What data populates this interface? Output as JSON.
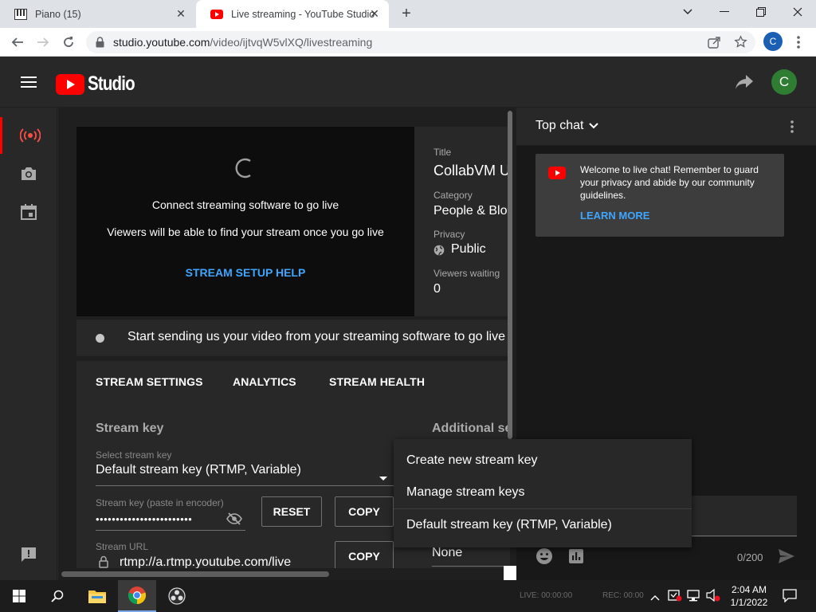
{
  "browser": {
    "tabs": [
      {
        "title": "Piano (15)",
        "icon": "piano-icon"
      },
      {
        "title": "Live streaming - YouTube Studio",
        "icon": "youtube-icon"
      }
    ],
    "url_host": "studio.youtube.com",
    "url_path": "/video/ijtvqW5vlXQ/livestreaming",
    "profile_initial": "C"
  },
  "header": {
    "logo_text": "Studio",
    "avatar_initial": "C"
  },
  "preview": {
    "line1": "Connect streaming software to go live",
    "line2": "Viewers will be able to find your stream once you go live",
    "help_link": "STREAM SETUP HELP"
  },
  "info": {
    "title_label": "Title",
    "title_value": "CollabVM U",
    "category_label": "Category",
    "category_value": "People & Blo",
    "privacy_label": "Privacy",
    "privacy_value": "Public",
    "viewers_label": "Viewers waiting",
    "viewers_value": "0"
  },
  "status": {
    "text": "Start sending us your video from your streaming software to go live"
  },
  "settings": {
    "tabs": [
      "STREAM SETTINGS",
      "ANALYTICS",
      "STREAM HEALTH"
    ],
    "stream_key_heading": "Stream key",
    "additional_heading": "Additional se",
    "select_label": "Select stream key",
    "select_value": "Default stream key (RTMP, Variable)",
    "key_label": "Stream key (paste in encoder)",
    "key_value": "••••••••••••••••••••••••",
    "reset_label": "RESET",
    "copy_label": "COPY",
    "url_label": "Stream URL",
    "url_value": "rtmp://a.rtmp.youtube.com/live",
    "copy2_label": "COPY",
    "none_value": "None"
  },
  "chat": {
    "header": "Top chat",
    "welcome_text": "Welcome to live chat! Remember to guard your privacy and abide by our community guidelines.",
    "learn_more": "LEARN MORE",
    "counter": "0/200"
  },
  "menu": {
    "items": [
      "Create new stream key",
      "Manage stream keys",
      "Default stream key (RTMP, Variable)"
    ]
  },
  "taskbar": {
    "time": "2:04 AM",
    "date": "1/1/2022",
    "live_status": "LIVE: 00:00:00",
    "rec_status": "REC: 00:00"
  },
  "colors": {
    "accent_red": "#ff0000",
    "link_blue": "#3ea6ff",
    "avatar_green": "#2e7d32"
  }
}
